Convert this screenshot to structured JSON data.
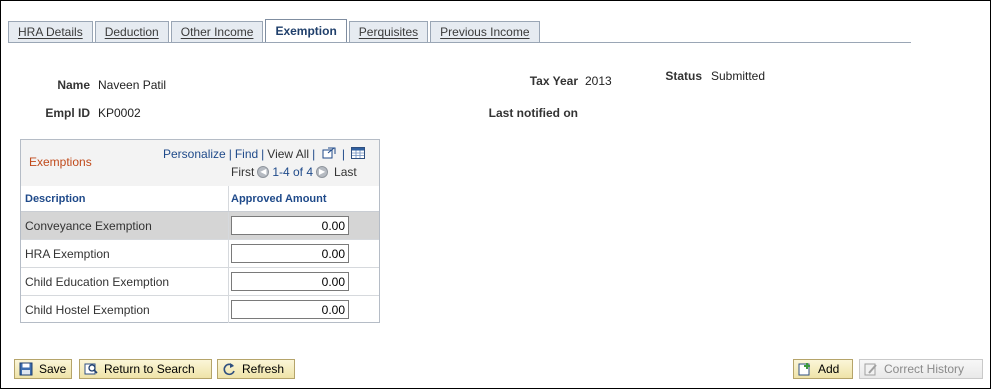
{
  "tabs": [
    {
      "label": "HRA Details",
      "active": false
    },
    {
      "label": "Deduction",
      "active": false
    },
    {
      "label": "Other Income",
      "active": false
    },
    {
      "label": "Exemption",
      "active": true
    },
    {
      "label": "Perquisites",
      "active": false
    },
    {
      "label": "Previous Income",
      "active": false
    }
  ],
  "header": {
    "name_label": "Name",
    "name_value": "Naveen Patil",
    "emplid_label": "Empl ID",
    "emplid_value": "KP0002",
    "taxyear_label": "Tax Year",
    "taxyear_value": "2013",
    "status_label": "Status",
    "status_value": "Submitted",
    "last_notified_label": "Last notified on"
  },
  "grid": {
    "title": "Exemptions",
    "personalize": "Personalize",
    "find": "Find",
    "view_all": "View All",
    "first": "First",
    "range": "1-4 of 4",
    "last": "Last",
    "col_description": "Description",
    "col_amount": "Approved Amount",
    "rows": [
      {
        "description": "Conveyance Exemption",
        "amount": "0.00"
      },
      {
        "description": "HRA Exemption",
        "amount": "0.00"
      },
      {
        "description": "Child Education Exemption",
        "amount": "0.00"
      },
      {
        "description": "Child Hostel Exemption",
        "amount": "0.00"
      }
    ]
  },
  "toolbar": {
    "save": "Save",
    "return_to_search": "Return to Search",
    "refresh": "Refresh",
    "add": "Add",
    "correct_history": "Correct History"
  },
  "icons": {
    "save": "save-icon",
    "return": "return-to-search-icon",
    "refresh": "refresh-icon",
    "add": "add-icon",
    "correct_history": "correct-history-icon",
    "new_window": "new-window-icon",
    "download": "download-grid-icon",
    "prev": "previous-arrow-icon",
    "next": "next-arrow-icon"
  }
}
